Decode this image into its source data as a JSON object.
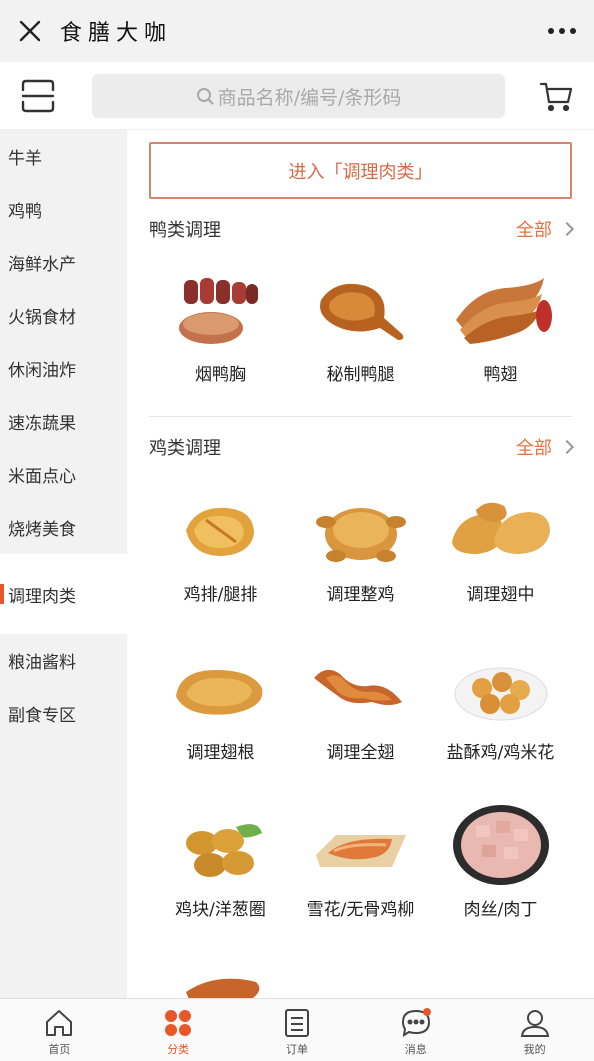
{
  "header": {
    "title": "食膳大咖"
  },
  "search": {
    "placeholder": "商品名称/编号/条形码"
  },
  "sidebar": {
    "items": [
      {
        "label": "牛羊"
      },
      {
        "label": "鸡鸭"
      },
      {
        "label": "海鲜水产"
      },
      {
        "label": "火锅食材"
      },
      {
        "label": "休闲油炸"
      },
      {
        "label": "速冻蔬果"
      },
      {
        "label": "米面点心"
      },
      {
        "label": "烧烤美食"
      },
      {
        "label": "调理肉类"
      },
      {
        "label": "粮油酱料"
      },
      {
        "label": "副食专区"
      }
    ],
    "active_index": 8
  },
  "main": {
    "enter_label": "进入「调理肉类」",
    "sections": [
      {
        "title": "鸭类调理",
        "all_label": "全部",
        "items": [
          {
            "label": "烟鸭胸",
            "icon": "smoked-duck-breast"
          },
          {
            "label": "秘制鸭腿",
            "icon": "duck-leg"
          },
          {
            "label": "鸭翅",
            "icon": "duck-wings"
          }
        ]
      },
      {
        "title": "鸡类调理",
        "all_label": "全部",
        "items": [
          {
            "label": "鸡排/腿排",
            "icon": "chicken-cutlet"
          },
          {
            "label": "调理整鸡",
            "icon": "whole-chicken"
          },
          {
            "label": "调理翅中",
            "icon": "wing-middles"
          },
          {
            "label": "调理翅根",
            "icon": "drumettes"
          },
          {
            "label": "调理全翅",
            "icon": "whole-wing"
          },
          {
            "label": "盐酥鸡/鸡米花",
            "icon": "popcorn-chicken"
          },
          {
            "label": "鸡块/洋葱圈",
            "icon": "nuggets"
          },
          {
            "label": "雪花/无骨鸡柳",
            "icon": "chicken-strips"
          },
          {
            "label": "肉丝/肉丁",
            "icon": "diced-meat"
          }
        ]
      }
    ]
  },
  "tabbar": {
    "tabs": [
      {
        "label": "首页",
        "icon": "home-icon"
      },
      {
        "label": "分类",
        "icon": "category-icon"
      },
      {
        "label": "订单",
        "icon": "order-icon"
      },
      {
        "label": "消息",
        "icon": "message-icon"
      },
      {
        "label": "我的",
        "icon": "profile-icon"
      }
    ],
    "active_index": 1
  },
  "colors": {
    "accent": "#e8572a",
    "all_link": "#e8713f",
    "food_light": "#e7a34a",
    "food_dark": "#b8621f"
  }
}
